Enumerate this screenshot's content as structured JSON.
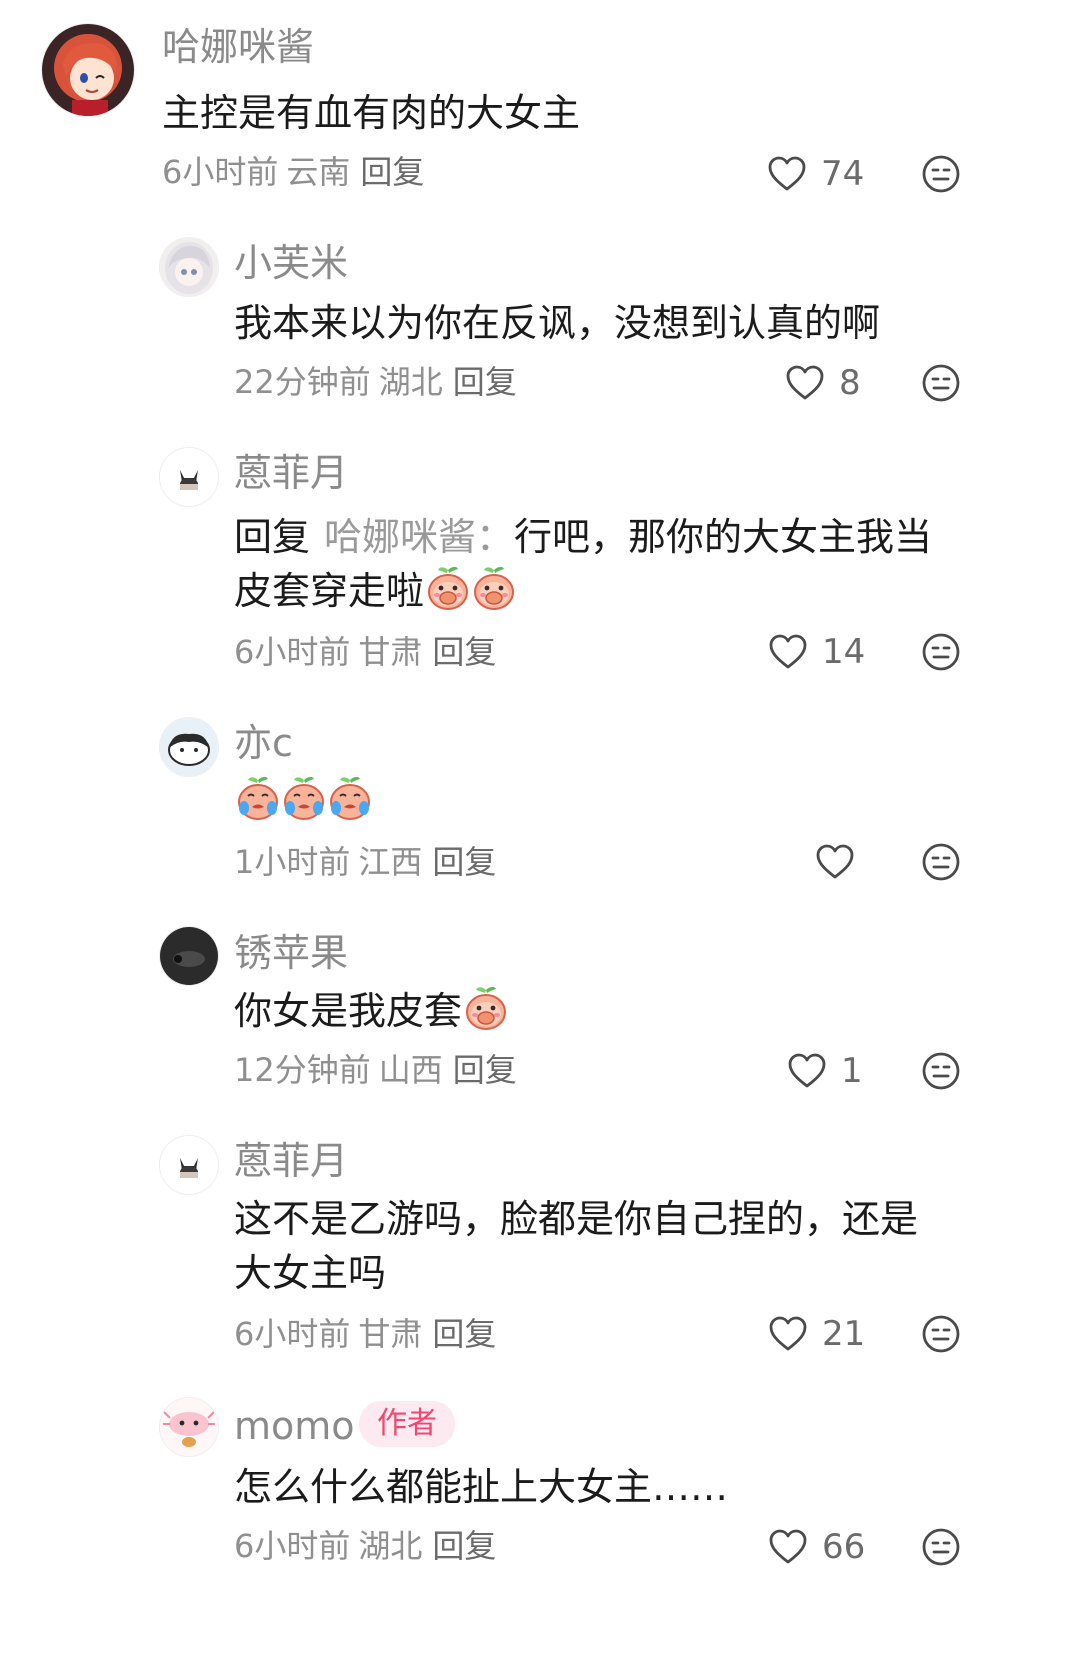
{
  "comments": [
    {
      "name": "哈娜咪酱",
      "text": "主控是有血有肉的大女主",
      "time": "6小时前",
      "region": "云南",
      "reply_label": "回复",
      "likes": "74",
      "avatar_icon": "anime-red-hair-avatar"
    },
    {
      "name": "小芙米",
      "text": "我本来以为你在反讽，没想到认真的啊",
      "time": "22分钟前",
      "region": "湖北",
      "reply_label": "回复",
      "likes": "8",
      "avatar_icon": "anime-white-hair-avatar"
    },
    {
      "name": "蒽菲月",
      "reply_prefix": "回复",
      "reply_target": "哈娜咪酱：",
      "text_line1": "行吧，那你的大女主我当",
      "text_line2": "皮套穿走啦",
      "emojis": [
        "peach-covering-mouth-emoji",
        "peach-covering-mouth-emoji"
      ],
      "time": "6小时前",
      "region": "甘肃",
      "reply_label": "回复",
      "likes": "14",
      "avatar_icon": "chibi-cat-avatar"
    },
    {
      "name": "亦c",
      "emojis": [
        "peach-crying-emoji",
        "peach-crying-emoji",
        "peach-crying-emoji"
      ],
      "time": "1小时前",
      "region": "江西",
      "reply_label": "回复",
      "likes": "",
      "avatar_icon": "panda-cat-avatar"
    },
    {
      "name": "锈苹果",
      "text": "你女是我皮套",
      "emojis": [
        "peach-covering-mouth-emoji"
      ],
      "time": "12分钟前",
      "region": "山西",
      "reply_label": "回复",
      "likes": "1",
      "avatar_icon": "dark-object-avatar"
    },
    {
      "name": "蒽菲月",
      "text_line1": "这不是乙游吗，脸都是你自己捏的，还是",
      "text_line2": "大女主吗",
      "time": "6小时前",
      "region": "甘肃",
      "reply_label": "回复",
      "likes": "21",
      "avatar_icon": "chibi-cat-avatar"
    },
    {
      "name": "momo",
      "badge": "作者",
      "text": "怎么什么都能扯上大女主……",
      "time": "6小时前",
      "region": "湖北",
      "reply_label": "回复",
      "likes": "66",
      "avatar_icon": "pink-axolotl-avatar"
    }
  ],
  "colors": {
    "username": "#8a8a8a",
    "body_text": "#1b1b1b",
    "meta_text": "#8f8f8f",
    "badge_bg": "#fdeaf0",
    "badge_text": "#f0466f"
  }
}
